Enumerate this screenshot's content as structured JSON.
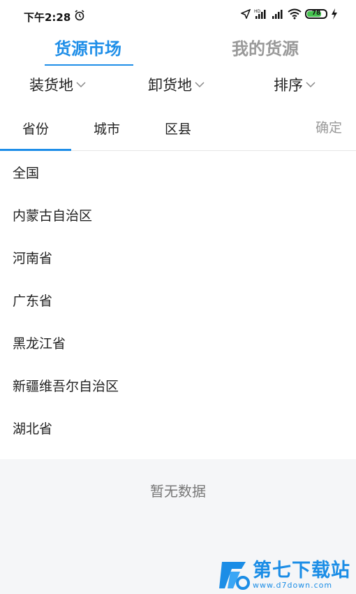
{
  "status_bar": {
    "time": "下午2:28",
    "battery": "78",
    "icons": [
      "alarm-icon",
      "location-icon",
      "hd-signal-icon",
      "signal-icon",
      "wifi-icon",
      "battery-icon",
      "charging-icon"
    ]
  },
  "top_tabs": {
    "active": "货源市场",
    "inactive": "我的货源",
    "accent": "#1e8ee8"
  },
  "filters": {
    "loading": "装货地",
    "unloading": "卸货地",
    "sort": "排序"
  },
  "region_tabs": {
    "province": "省份",
    "city": "城市",
    "district": "区县",
    "confirm": "确定"
  },
  "provinces": [
    "全国",
    "内蒙古自治区",
    "河南省",
    "广东省",
    "黑龙江省",
    "新疆维吾尔自治区",
    "湖北省"
  ],
  "empty": {
    "text": "暂无数据"
  },
  "watermark": {
    "name": "第七下载站",
    "url": "www.d7down.com"
  }
}
